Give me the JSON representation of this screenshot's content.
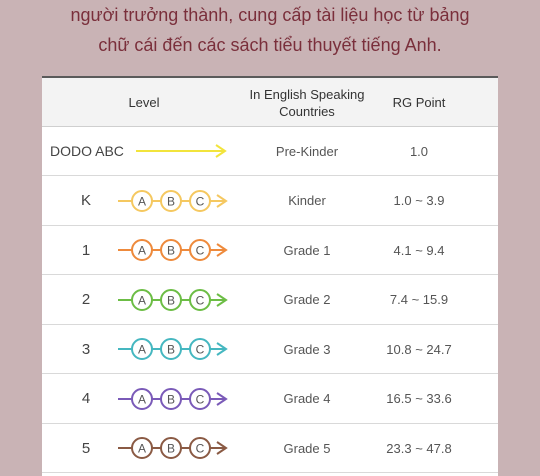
{
  "intro": {
    "line1": "người trưởng thành, cung cấp tài liệu học từ bảng",
    "line2": "chữ cái đến các sách tiểu thuyết tiếng Anh."
  },
  "table": {
    "headers": {
      "level": "Level",
      "countries_line1": "In English Speaking",
      "countries_line2": "Countries",
      "rg": "RG Point"
    },
    "rows": [
      {
        "level": "DODO ABC",
        "country": "Pre-Kinder",
        "rg": "1.0",
        "color": "#f2e43c",
        "letters": []
      },
      {
        "level": "K",
        "country": "Kinder",
        "rg": "1.0 ~ 3.9",
        "color": "#f5c860",
        "letters": [
          "A",
          "B",
          "C"
        ]
      },
      {
        "level": "1",
        "country": "Grade 1",
        "rg": "4.1 ~ 9.4",
        "color": "#ee8a3c",
        "letters": [
          "A",
          "B",
          "C"
        ]
      },
      {
        "level": "2",
        "country": "Grade 2",
        "rg": "7.4 ~ 15.9",
        "color": "#6cbd45",
        "letters": [
          "A",
          "B",
          "C"
        ]
      },
      {
        "level": "3",
        "country": "Grade 3",
        "rg": "10.8 ~ 24.7",
        "color": "#45b7c0",
        "letters": [
          "A",
          "B",
          "C"
        ]
      },
      {
        "level": "4",
        "country": "Grade 4",
        "rg": "16.5 ~ 33.6",
        "color": "#7a5ab8",
        "letters": [
          "A",
          "B",
          "C"
        ]
      },
      {
        "level": "5",
        "country": "Grade 5",
        "rg": "23.3 ~ 47.8",
        "color": "#8a5a44",
        "letters": [
          "A",
          "B",
          "C"
        ]
      }
    ]
  }
}
